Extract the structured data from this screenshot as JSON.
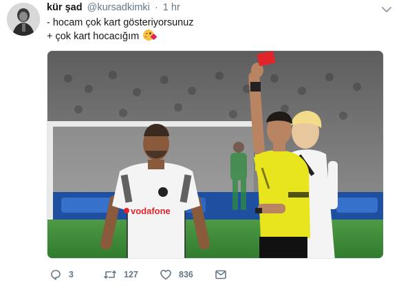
{
  "author": {
    "display_name": "kür şad",
    "handle": "@kursadkimki",
    "separator": "·",
    "time": "1 hr"
  },
  "tweet": {
    "lines": [
      "- hocam çok kart gösteriyorsunuz",
      "+ çok kart hocacığım"
    ],
    "emoji": "face-blowing-a-kiss"
  },
  "media": {
    "description_icon": "photo",
    "jersey_text": "vodafone"
  },
  "actions": {
    "reply_count": "3",
    "retweet_count": "127",
    "like_count": "836"
  },
  "colors": {
    "text": "#14171a",
    "secondary": "#657786",
    "pitch": "#3f8a3a",
    "red_card": "#e0242a",
    "referee_yellow": "#e8e41e"
  }
}
